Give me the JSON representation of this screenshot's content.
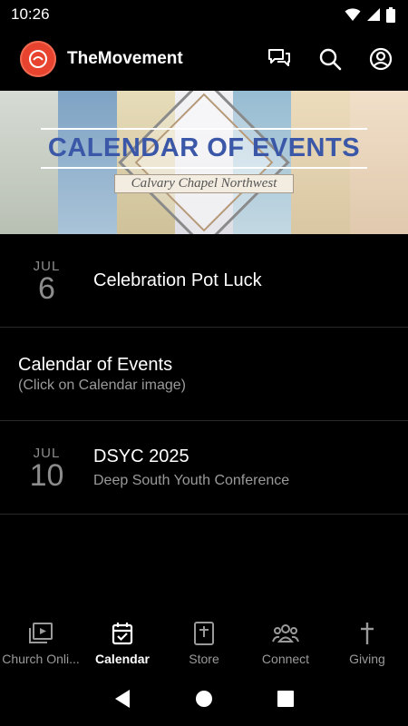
{
  "status": {
    "time": "10:26"
  },
  "app": {
    "title": "TheMovement"
  },
  "banner": {
    "title": "CALENDAR OF EVENTS",
    "subtitle": "Calvary Chapel Northwest",
    "colors": [
      "#c9cfc9",
      "#8faec9",
      "#e2d6b4",
      "#e9e9ee",
      "#a7c6d6",
      "#e6d5b6",
      "#e9d6c0",
      "#bcd2dc"
    ]
  },
  "events": [
    {
      "month": "JUL",
      "day": "6",
      "title": "Celebration Pot Luck",
      "subtitle": ""
    },
    {
      "title": "Calendar of Events",
      "subtitle": "(Click on Calendar image)"
    },
    {
      "month": "JUL",
      "day": "10",
      "title": "DSYC 2025",
      "subtitle": "Deep South Youth Conference"
    }
  ],
  "nav": [
    {
      "label": "Church Onli...",
      "icon": "video-library-icon"
    },
    {
      "label": "Calendar",
      "icon": "calendar-icon",
      "active": true
    },
    {
      "label": "Store",
      "icon": "bible-icon"
    },
    {
      "label": "Connect",
      "icon": "people-icon"
    },
    {
      "label": "Giving",
      "icon": "cross-icon"
    }
  ]
}
